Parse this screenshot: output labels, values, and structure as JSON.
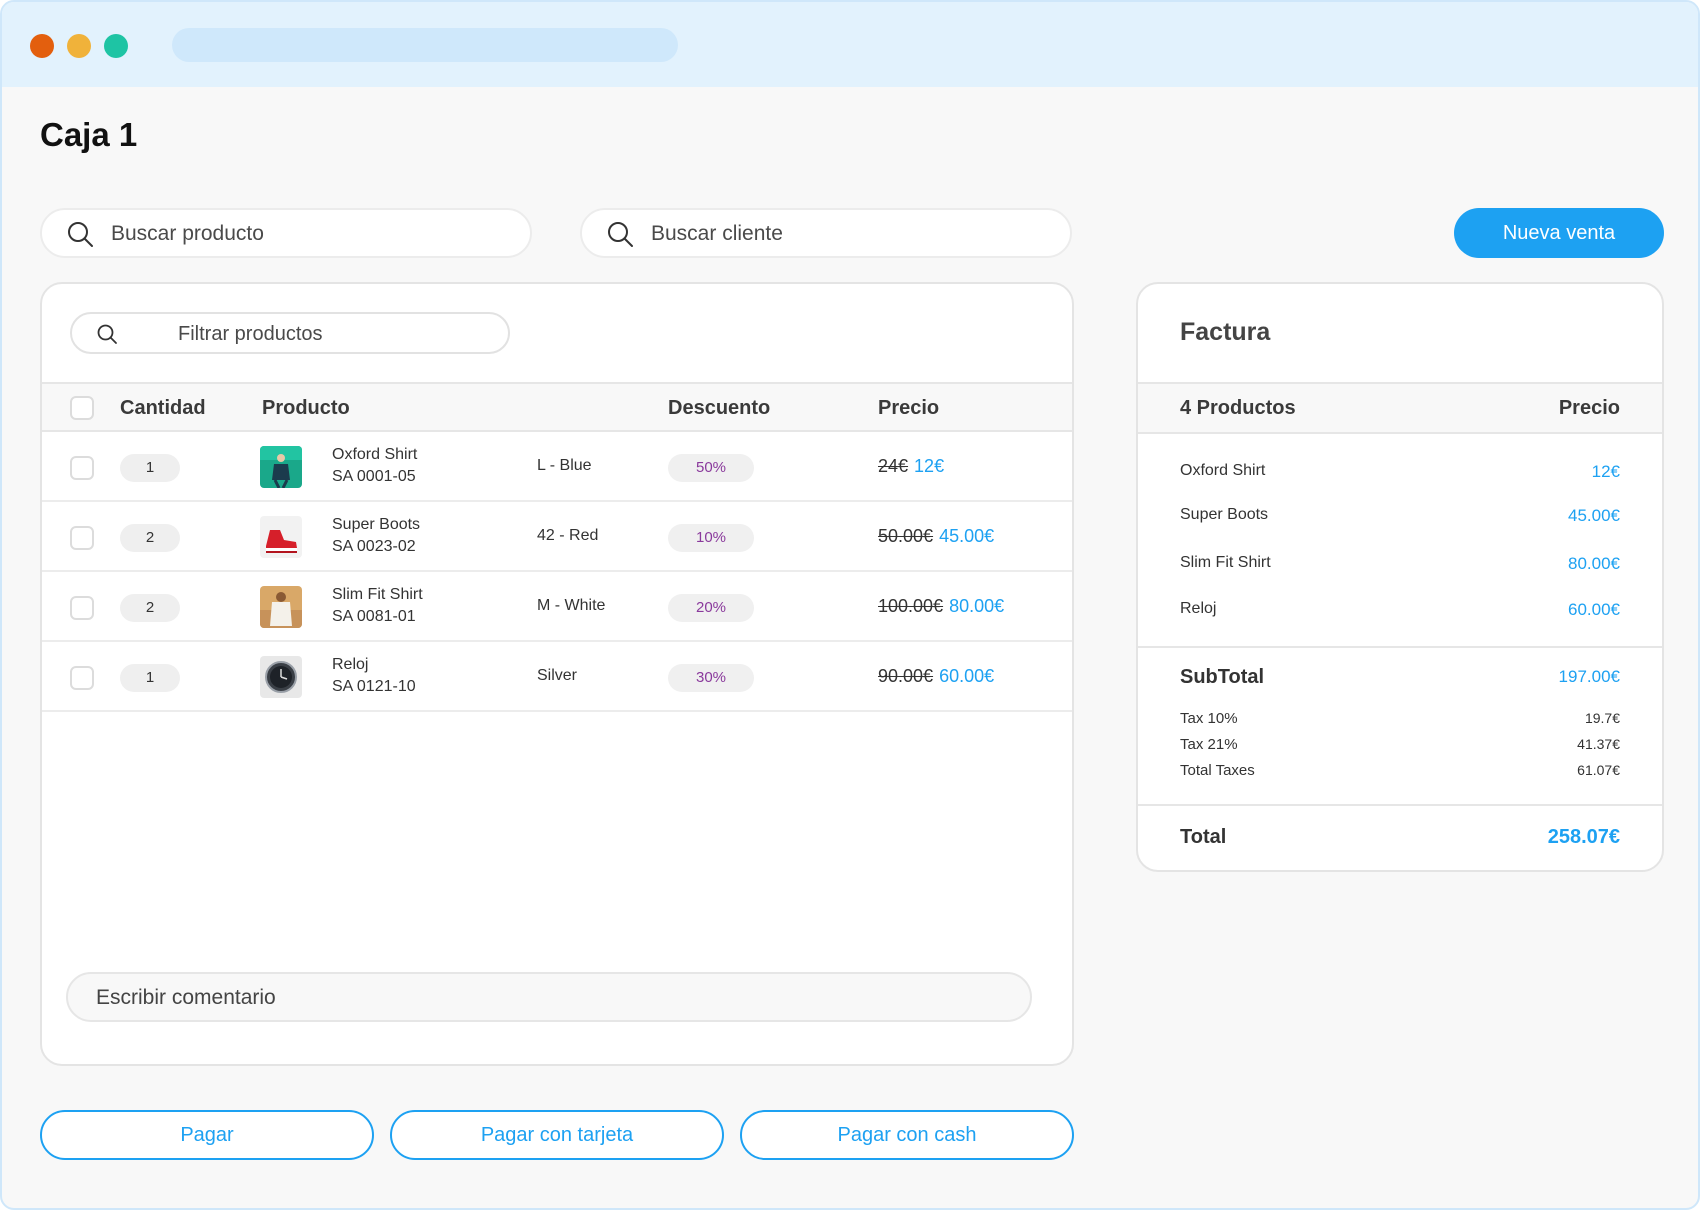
{
  "page": {
    "title": "Caja 1"
  },
  "toolbar": {
    "search_product_placeholder": "Buscar producto",
    "search_client_placeholder": "Buscar cliente",
    "new_sale_label": "Nueva venta"
  },
  "products": {
    "filter_placeholder": "Filtrar productos",
    "columns": {
      "quantity": "Cantidad",
      "product": "Producto",
      "discount": "Descuento",
      "price": "Precio"
    },
    "rows": [
      {
        "qty": "1",
        "name": "Oxford Shirt",
        "sku": "SA 0001-05",
        "variant": "L - Blue",
        "discount": "50%",
        "old_price": "24€",
        "new_price": "12€",
        "thumb": "shirt-photo"
      },
      {
        "qty": "2",
        "name": "Super Boots",
        "sku": "SA 0023-02",
        "variant": "42 - Red",
        "discount": "10%",
        "old_price": "50.00€",
        "new_price": "45.00€",
        "thumb": "boots-photo"
      },
      {
        "qty": "2",
        "name": "Slim Fit Shirt",
        "sku": "SA 0081-01",
        "variant": "M - White",
        "discount": "20%",
        "old_price": "100.00€",
        "new_price": "80.00€",
        "thumb": "slim-shirt-photo"
      },
      {
        "qty": "1",
        "name": "Reloj",
        "sku": "SA 0121-10",
        "variant": "Silver",
        "discount": "30%",
        "old_price": "90.00€",
        "new_price": "60.00€",
        "thumb": "watch-photo"
      }
    ],
    "comment_placeholder": "Escribir comentario"
  },
  "payment": {
    "pay": "Pagar",
    "pay_card": "Pagar con tarjeta",
    "pay_cash": "Pagar con cash"
  },
  "invoice": {
    "title": "Factura",
    "count_label": "4 Productos",
    "price_label": "Precio",
    "items": [
      {
        "name": "Oxford Shirt",
        "price": "12€"
      },
      {
        "name": "Super Boots",
        "price": "45.00€"
      },
      {
        "name": "Slim Fit Shirt",
        "price": "80.00€"
      },
      {
        "name": "Reloj",
        "price": "60.00€"
      }
    ],
    "subtotal_label": "SubTotal",
    "subtotal": "197.00€",
    "taxes": [
      {
        "label": "Tax 10%",
        "value": "19.7€"
      },
      {
        "label": "Tax 21%",
        "value": "41.37€"
      },
      {
        "label": "Total Taxes",
        "value": "61.07€"
      }
    ],
    "total_label": "Total",
    "total": "258.07€"
  },
  "colors": {
    "accent": "#1da1f2",
    "discount_text": "#8a3a9c",
    "titlebar": "#e2f2fd"
  }
}
